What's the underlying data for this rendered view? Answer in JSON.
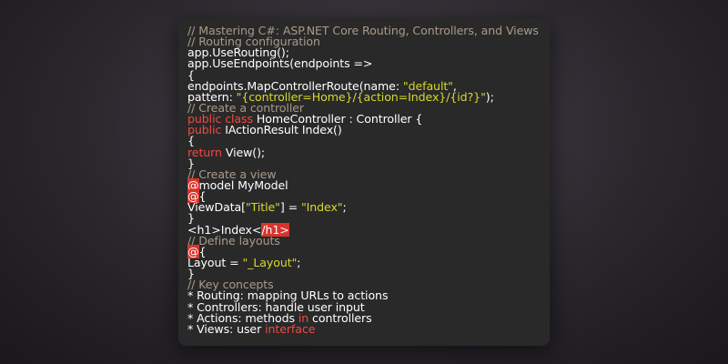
{
  "colors": {
    "background": "#2a272d",
    "editor_background": "#29292a",
    "comment": "#aa9a86",
    "keyword": "#ef4a40",
    "string": "#d6d82d",
    "text": "#ffffff",
    "highlight": "#d8342c"
  },
  "code": {
    "lines": [
      [
        {
          "t": "// Mastering C#: ASP.NET Core Routing, Controllers, and Views",
          "k": "comment"
        }
      ],
      [
        {
          "t": "// Routing configuration",
          "k": "comment"
        }
      ],
      [
        {
          "t": "app.UseRouting();",
          "k": "plain"
        }
      ],
      [
        {
          "t": "app.UseEndpoints(endpoints =>",
          "k": "plain"
        }
      ],
      [
        {
          "t": "{",
          "k": "plain"
        }
      ],
      [
        {
          "t": "endpoints.MapControllerRoute(name: ",
          "k": "plain"
        },
        {
          "t": "\"default\"",
          "k": "string"
        },
        {
          "t": ",",
          "k": "plain"
        }
      ],
      [
        {
          "t": "pattern: ",
          "k": "plain"
        },
        {
          "t": "\"{controller=Home}/{action=Index}/{id?}\"",
          "k": "string"
        },
        {
          "t": ");",
          "k": "plain"
        }
      ],
      [
        {
          "t": "// Create a controller",
          "k": "comment"
        }
      ],
      [
        {
          "t": "public class",
          "k": "keyword"
        },
        {
          "t": " HomeController : Controller {",
          "k": "plain"
        }
      ],
      [
        {
          "t": "public",
          "k": "keyword"
        },
        {
          "t": " IActionResult Index()",
          "k": "plain"
        }
      ],
      [
        {
          "t": "{",
          "k": "plain"
        }
      ],
      [
        {
          "t": "return",
          "k": "keyword"
        },
        {
          "t": " View();",
          "k": "plain"
        }
      ],
      [
        {
          "t": "}",
          "k": "plain"
        }
      ],
      [
        {
          "t": "// Create a view",
          "k": "comment"
        }
      ],
      [
        {
          "t": "@",
          "k": "highlight"
        },
        {
          "t": "model MyModel",
          "k": "plain"
        }
      ],
      [
        {
          "t": "@",
          "k": "highlight"
        },
        {
          "t": "{",
          "k": "plain"
        }
      ],
      [
        {
          "t": "ViewData[",
          "k": "plain"
        },
        {
          "t": "\"Title\"",
          "k": "string"
        },
        {
          "t": "] = ",
          "k": "plain"
        },
        {
          "t": "\"Index\"",
          "k": "string"
        },
        {
          "t": ";",
          "k": "plain"
        }
      ],
      [
        {
          "t": "}",
          "k": "plain"
        }
      ],
      [
        {
          "t": "<h1>Index<",
          "k": "plain"
        },
        {
          "t": "/h1>",
          "k": "highlight"
        }
      ],
      [
        {
          "t": "// Define layouts",
          "k": "comment"
        }
      ],
      [
        {
          "t": "@",
          "k": "highlight"
        },
        {
          "t": "{",
          "k": "plain"
        }
      ],
      [
        {
          "t": "Layout = ",
          "k": "plain"
        },
        {
          "t": "\"_Layout\"",
          "k": "string"
        },
        {
          "t": ";",
          "k": "plain"
        }
      ],
      [
        {
          "t": "}",
          "k": "plain"
        }
      ],
      [
        {
          "t": "// Key concepts",
          "k": "comment"
        }
      ],
      [
        {
          "t": "* Routing: mapping URLs to actions",
          "k": "plain"
        }
      ],
      [
        {
          "t": "* Controllers: handle user input",
          "k": "plain"
        }
      ],
      [
        {
          "t": "* Actions: methods ",
          "k": "plain"
        },
        {
          "t": "in",
          "k": "keyword"
        },
        {
          "t": " controllers",
          "k": "plain"
        }
      ],
      [
        {
          "t": "* Views: user ",
          "k": "plain"
        },
        {
          "t": "interface",
          "k": "keyword"
        }
      ]
    ]
  }
}
